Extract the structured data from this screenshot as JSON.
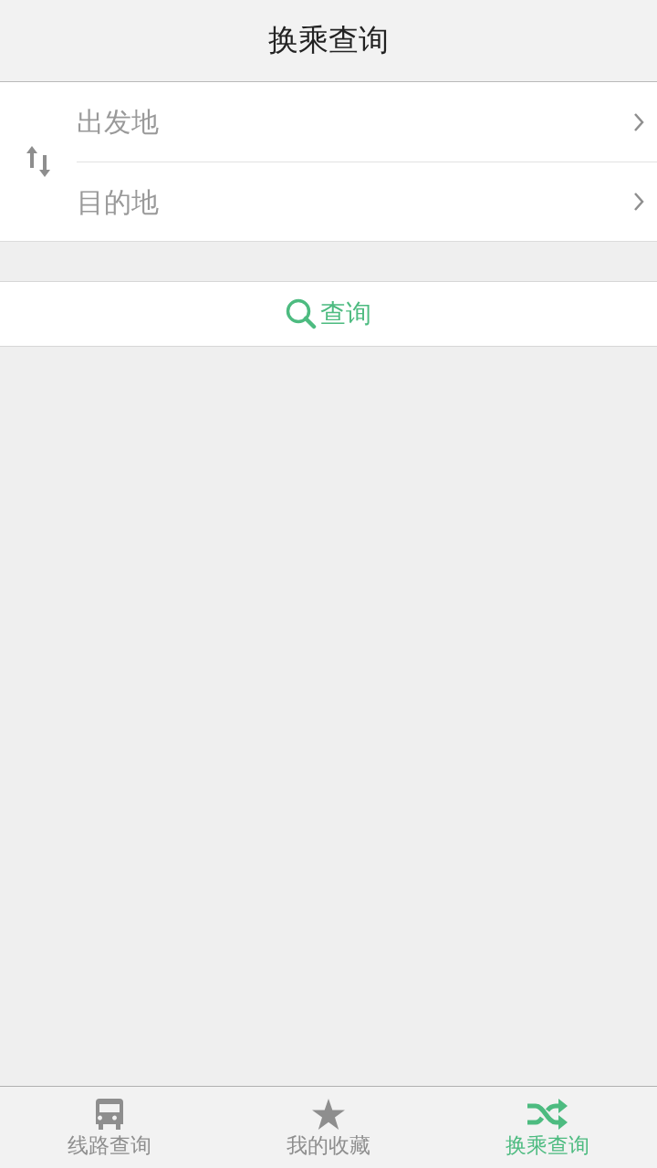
{
  "header": {
    "title": "换乘查询"
  },
  "route_fields": [
    {
      "placeholder": "出发地"
    },
    {
      "placeholder": "目的地"
    }
  ],
  "search_button": {
    "label": "查询"
  },
  "tab_bar": [
    {
      "label": "线路查询",
      "kind": "bus",
      "selected": false
    },
    {
      "label": "我的收藏",
      "kind": "star",
      "selected": false
    },
    {
      "label": "换乘查询",
      "kind": "shuffle",
      "selected": true
    }
  ]
}
